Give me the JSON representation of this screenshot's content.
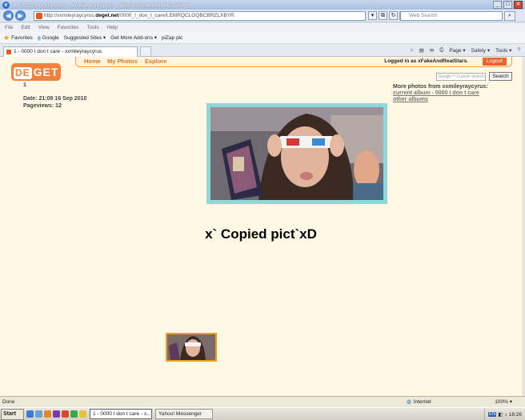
{
  "browser": {
    "window_title": "1 - 0000 I don t care - xxmileyraycyrus - Windows Internet Explorer",
    "address_prefix": "http://xxmileyraycyrus.",
    "address_domain": "deget.net",
    "address_suffix": "/0000_I_don_t_care/LEMRQCLOQBCBRZLXBYR",
    "web_search_placeholder": "Web Search",
    "menu": [
      "File",
      "Edit",
      "View",
      "Favorites",
      "Tools",
      "Help"
    ],
    "favorites": {
      "favorites_label": "Favorites",
      "google_label": "Google",
      "suggested_label": "Suggested Sites ▾",
      "addons_label": "Get More Add-ons ▾",
      "pizap_label": "piZap pic"
    },
    "tab_label": "1 - 0000 I don t care - xxmileyraycyrus",
    "commands": {
      "page": "Page ▾",
      "safety": "Safety ▾",
      "tools": "Tools ▾"
    }
  },
  "site": {
    "logo_de": "DE",
    "logo_get": "GET",
    "nav": {
      "home": "Home",
      "my_photos": "My Photos",
      "explore": "Explore"
    },
    "logged_in_text": "Logged in as xFakeAndRealStars.",
    "logout_label": "Logout",
    "search_placeholder": "Google™ Custom Search",
    "search_button": "Search"
  },
  "photo_page": {
    "number": "1",
    "date": "Date: 21:09 16 Sep 2010",
    "pageviews": "Pageviews: 12",
    "caption": "x` Copied pict`xD",
    "more_photos_title": "More photos from xxmileyraycyrus:",
    "current_album_link": "current album - 0000 I don t care",
    "other_albums_link": "other albums"
  },
  "statusbar": {
    "status": "Done",
    "zone": "Internet",
    "zoom": "100% ▾"
  },
  "taskbar": {
    "start_label": "Start",
    "task_ie": "1 - 0000 I don t care - x...",
    "task_yahoo": "Yahoo! Messenger",
    "lang": "EN",
    "clock": "18:26"
  },
  "colors": {
    "page_bg": "#fff8e5",
    "accent_orange": "#e07820",
    "photo_border": "#8fd8d8",
    "thumb_border": "#e8a020"
  }
}
